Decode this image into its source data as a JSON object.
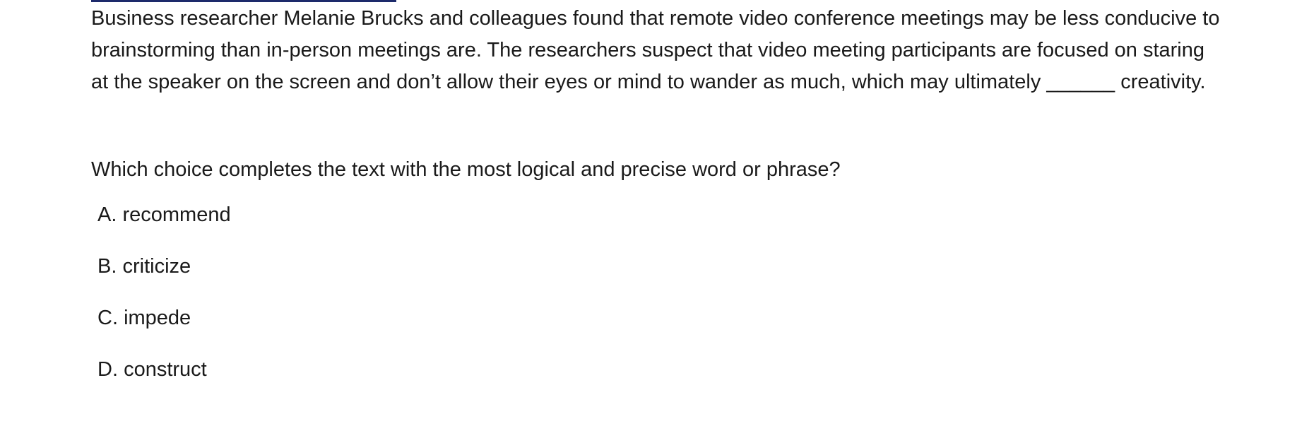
{
  "passage": {
    "text": "Business researcher Melanie Brucks and colleagues found that remote video conference meetings may be less conducive to brainstorming than in-person meetings are. The researchers suspect that video meeting participants are focused on staring at the speaker on the screen and don’t allow their eyes or mind to wander as much, which may ultimately ______ creativity."
  },
  "question": {
    "prompt": "Which choice completes the text with the most logical and precise word or phrase?"
  },
  "choices": [
    {
      "letter": "A.",
      "text": "recommend"
    },
    {
      "letter": "B.",
      "text": "criticize"
    },
    {
      "letter": "C.",
      "text": "impede"
    },
    {
      "letter": "D.",
      "text": "construct"
    }
  ],
  "colors": {
    "top_rule": "#1d2a6b",
    "text": "#1a1a1a"
  }
}
